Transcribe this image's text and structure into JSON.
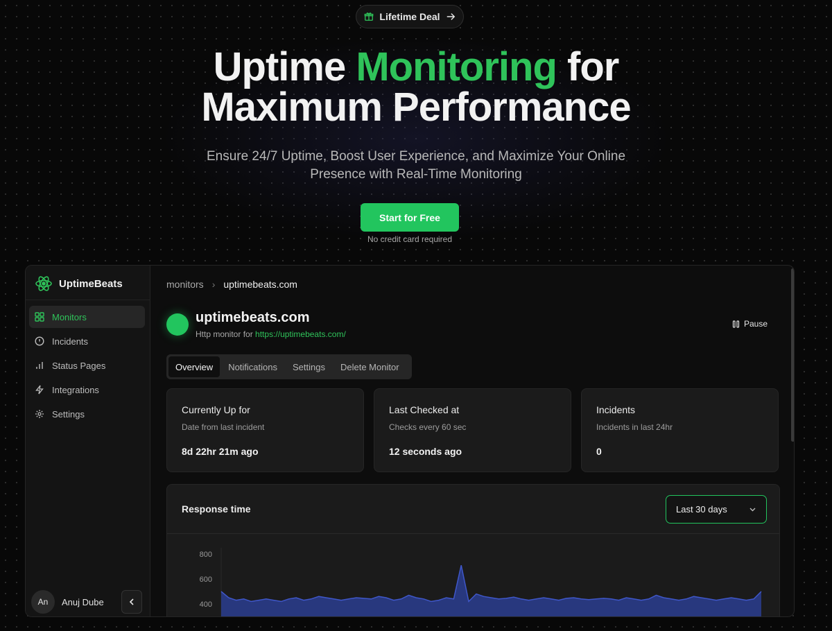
{
  "hero": {
    "deal_label": "Lifetime Deal",
    "headline_1": "Uptime",
    "headline_accent": "Monitoring",
    "headline_2": "for",
    "headline_3": "Maximum Performance",
    "subtitle": "Ensure 24/7 Uptime, Boost User Experience, and Maximize Your Online Presence with Real-Time Monitoring",
    "cta_label": "Start for Free",
    "cta_note": "No credit card required"
  },
  "sidebar": {
    "brand": "UptimeBeats",
    "items": [
      {
        "label": "Monitors",
        "icon": "grid-icon",
        "active": true
      },
      {
        "label": "Incidents",
        "icon": "alert-circle-icon"
      },
      {
        "label": "Status Pages",
        "icon": "bar-chart-icon"
      },
      {
        "label": "Integrations",
        "icon": "lightning-icon"
      },
      {
        "label": "Settings",
        "icon": "gear-icon"
      }
    ],
    "user": {
      "initials": "An",
      "name": "Anuj Dube"
    }
  },
  "breadcrumb": {
    "root": "monitors",
    "sep": "›",
    "current": "uptimebeats.com"
  },
  "monitor": {
    "title": "uptimebeats.com",
    "type_text": "Http monitor for",
    "url": "https://uptimebeats.com/",
    "pause_label": "Pause",
    "status_color": "#22c55e"
  },
  "tabs": [
    "Overview",
    "Notifications",
    "Settings",
    "Delete Monitor"
  ],
  "cards": [
    {
      "title": "Currently Up for",
      "sub": "Date from last incident",
      "value": "8d 22hr 21m ago"
    },
    {
      "title": "Last Checked at",
      "sub": "Checks every 60 sec",
      "value": "12 seconds ago"
    },
    {
      "title": "Incidents",
      "sub": "Incidents in last 24hr",
      "value": "0"
    }
  ],
  "response_chart": {
    "title": "Response time",
    "range_label": "Last 30 days",
    "accent_color": "#22c55e",
    "series_color": "#2a3d8f"
  },
  "chart_data": {
    "type": "area",
    "title": "Response time",
    "xlabel": "",
    "ylabel": "",
    "y_ticks": [
      "800",
      "600",
      "400"
    ],
    "ylim": [
      300,
      850
    ],
    "values": [
      500,
      450,
      430,
      440,
      420,
      430,
      440,
      430,
      420,
      440,
      450,
      430,
      440,
      460,
      450,
      440,
      430,
      440,
      450,
      445,
      440,
      460,
      450,
      430,
      440,
      470,
      450,
      440,
      420,
      430,
      450,
      440,
      710,
      420,
      480,
      460,
      450,
      440,
      445,
      455,
      440,
      430,
      440,
      450,
      440,
      430,
      445,
      450,
      440,
      435,
      440,
      445,
      440,
      430,
      450,
      440,
      430,
      440,
      470,
      450,
      440,
      430,
      440,
      460,
      450,
      440,
      430,
      440,
      450,
      440,
      430,
      440,
      500
    ]
  }
}
